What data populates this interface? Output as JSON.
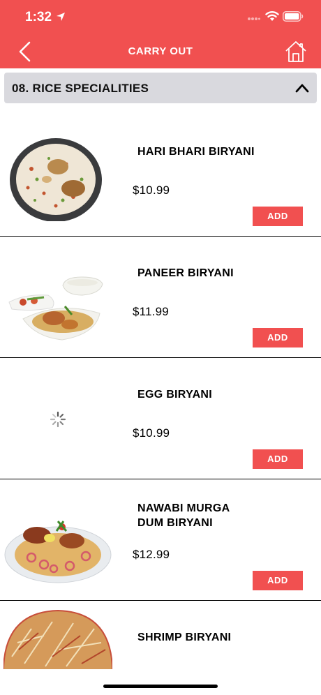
{
  "status_bar": {
    "time": "1:32"
  },
  "header": {
    "title": "CARRY OUT"
  },
  "category": {
    "label": "08. RICE SPECIALITIES"
  },
  "items": [
    {
      "name": "HARI BHARI BIRYANI",
      "price": "$10.99",
      "add_label": "ADD"
    },
    {
      "name": "PANEER BIRYANI",
      "price": "$11.99",
      "add_label": "ADD"
    },
    {
      "name": "EGG BIRYANI",
      "price": "$10.99",
      "add_label": "ADD"
    },
    {
      "name_line1": "NAWABI MURGA",
      "name_line2": "DUM BIRYANI",
      "price": "$12.99",
      "add_label": "ADD"
    },
    {
      "name": "SHRIMP BIRYANI"
    }
  ],
  "colors": {
    "accent": "#f15050",
    "category_bg": "#d9d9de"
  },
  "icons": [
    "location-arrow-icon",
    "signal-icon",
    "wifi-icon",
    "battery-icon",
    "chevron-left-icon",
    "home-icon",
    "chevron-up-icon",
    "loading-spinner-icon"
  ]
}
